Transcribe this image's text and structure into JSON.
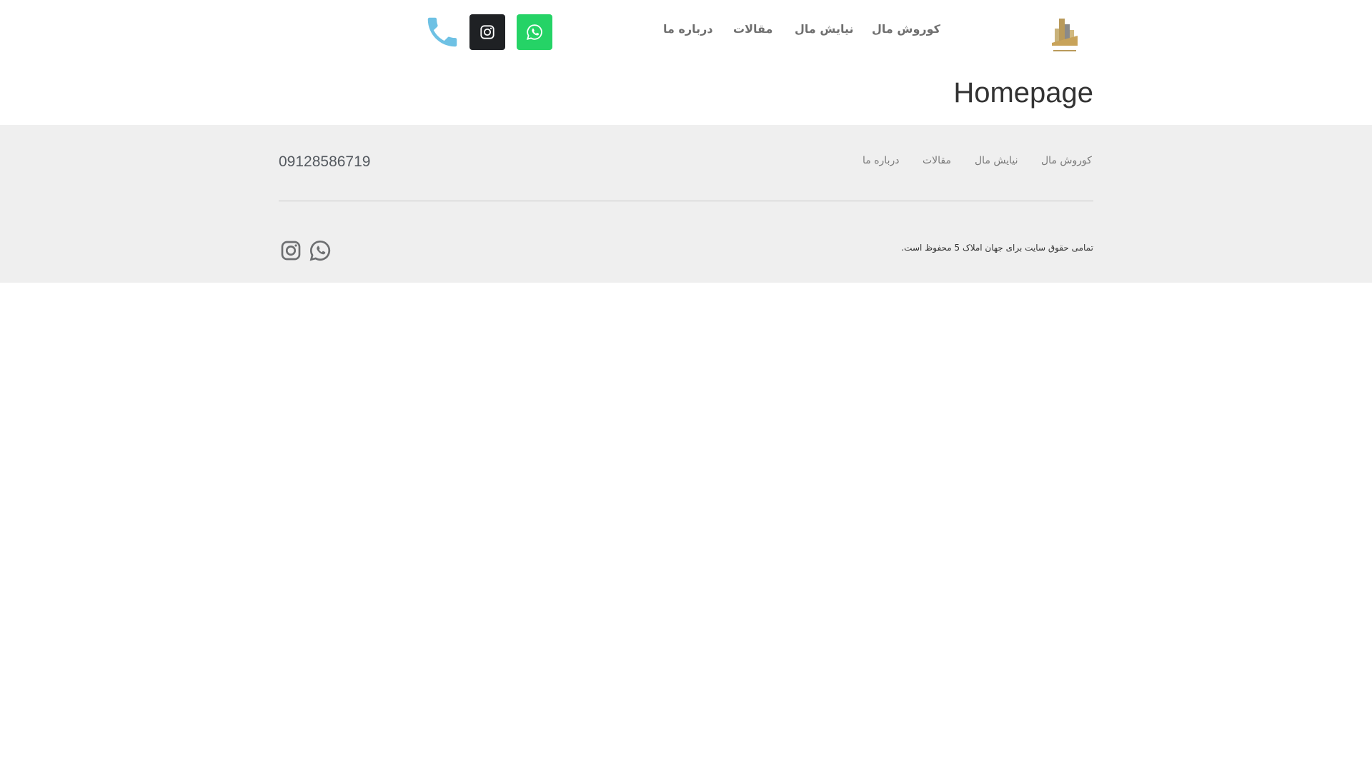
{
  "header": {
    "nav": [
      "کوروش مال",
      "نیایش مال",
      "مقالات",
      "درباره ما"
    ]
  },
  "main": {
    "title": "Homepage"
  },
  "footer": {
    "nav": [
      "کوروش مال",
      "نیایش مال",
      "مقالات",
      "درباره ما"
    ],
    "phone": "09128586719",
    "copyright": "تمامی حقوق سایت برای جهان املاک 5 محفوظ است."
  },
  "icons": {
    "logo": "building-logo-icon",
    "whatsapp": "whatsapp-icon",
    "instagram": "instagram-icon",
    "phone": "phone-icon"
  },
  "colors": {
    "whatsapp": "#25d366",
    "instagram_bg": "#1f2124",
    "phone": "#6ec1e4",
    "footer_bg": "#efefef"
  }
}
